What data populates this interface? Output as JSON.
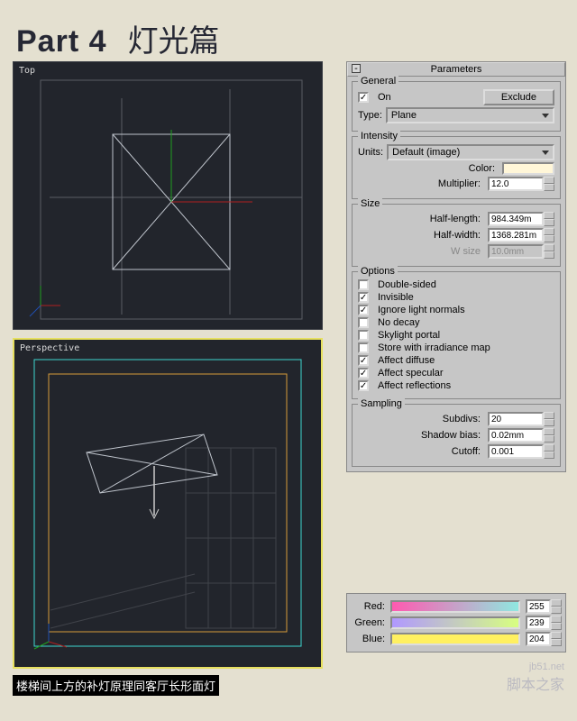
{
  "title": {
    "part": "Part 4",
    "zh": "灯光篇"
  },
  "viewports": {
    "top": "Top",
    "persp": "Perspective"
  },
  "caption": "楼梯间上方的补灯原理同客厅长形面灯",
  "panel": {
    "header": "Parameters",
    "general": {
      "t": "General",
      "on": "On",
      "on_chk": true,
      "exclude": "Exclude",
      "type_lbl": "Type:",
      "type": "Plane"
    },
    "intensity": {
      "t": "Intensity",
      "units_lbl": "Units:",
      "units": "Default (image)",
      "color_lbl": "Color:",
      "color": "#fff6d8",
      "mult_lbl": "Multiplier:",
      "mult": "12.0"
    },
    "size": {
      "t": "Size",
      "hl_lbl": "Half-length:",
      "hl": "984.349m",
      "hw_lbl": "Half-width:",
      "hw": "1368.281m",
      "ws_lbl": "W size",
      "ws": "10.0mm",
      "ws_dis": true
    },
    "options": {
      "t": "Options",
      "items": [
        {
          "label": "Double-sided",
          "chk": false
        },
        {
          "label": "Invisible",
          "chk": true
        },
        {
          "label": "Ignore light normals",
          "chk": true
        },
        {
          "label": "No decay",
          "chk": false
        },
        {
          "label": "Skylight portal",
          "chk": false
        },
        {
          "label": "Store with irradiance map",
          "chk": false
        },
        {
          "label": "Affect diffuse",
          "chk": true
        },
        {
          "label": "Affect specular",
          "chk": true
        },
        {
          "label": "Affect reflections",
          "chk": true
        }
      ]
    },
    "sampling": {
      "t": "Sampling",
      "subd_lbl": "Subdivs:",
      "subd": "20",
      "sb_lbl": "Shadow bias:",
      "sb": "0.02mm",
      "cut_lbl": "Cutoff:",
      "cut": "0.001"
    }
  },
  "rgb": {
    "r": {
      "lbl": "Red:",
      "val": "255",
      "grad": "linear-gradient(to right,#ff59b0,#8fe8e0)"
    },
    "g": {
      "lbl": "Green:",
      "val": "239",
      "grad": "linear-gradient(to right,#b098ff,#d8ff80)"
    },
    "b": {
      "lbl": "Blue:",
      "val": "204",
      "grad": "linear-gradient(to right,#fff060,#fff060)"
    }
  },
  "watermark": {
    "url": "jb51.net",
    "zh": "脚本之家"
  }
}
